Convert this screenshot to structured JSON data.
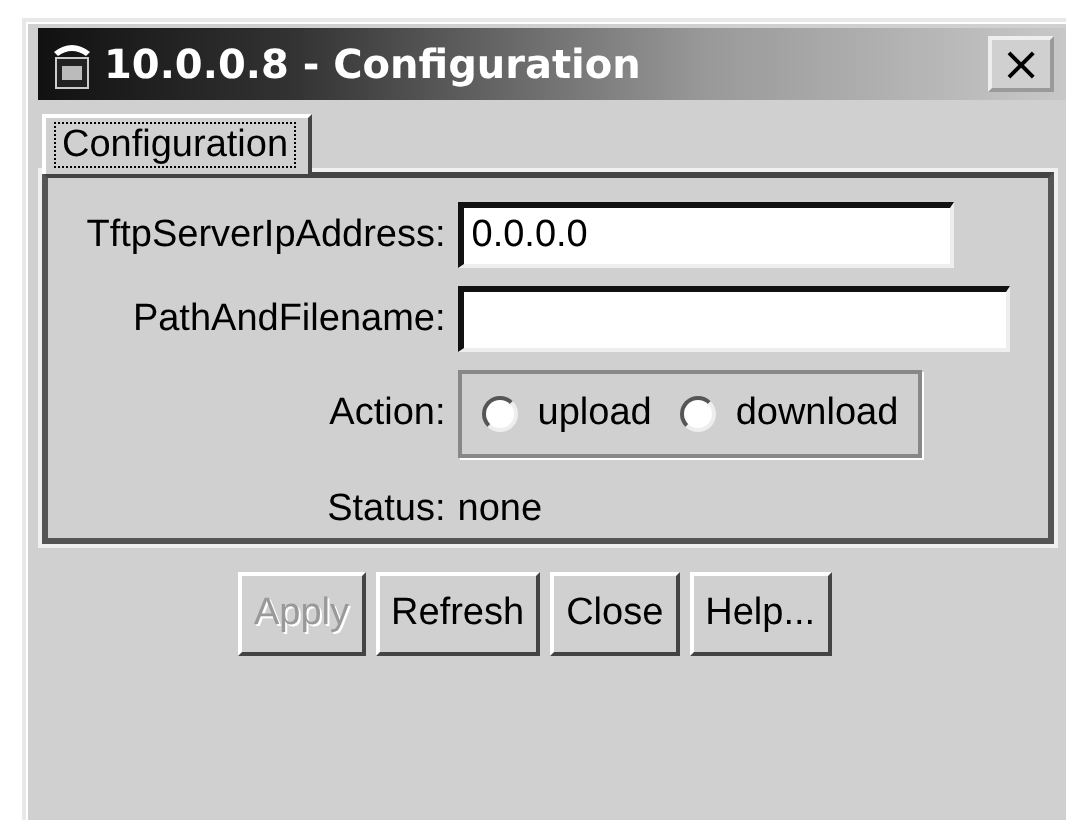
{
  "window": {
    "title": "10.0.0.8 - Configuration",
    "close": "×"
  },
  "tabs": [
    {
      "label": "Configuration",
      "selected": true
    }
  ],
  "fields": [
    {
      "label": "TftpServerIpAddress:",
      "value": "0.0.0.0"
    },
    {
      "label": "PathAndFilename:"
    }
  ],
  "action": {
    "label": "Action:",
    "options": [
      {
        "label": "upload",
        "selected": false
      },
      {
        "label": "download",
        "selected": false
      }
    ]
  },
  "status": {
    "label": "Status:",
    "value": "none"
  },
  "buttons": [
    {
      "label": "Apply",
      "disabled": true
    },
    {
      "label": "Refresh",
      "disabled": false
    },
    {
      "label": "Close",
      "disabled": false
    },
    {
      "label": "Help...",
      "disabled": false
    }
  ]
}
